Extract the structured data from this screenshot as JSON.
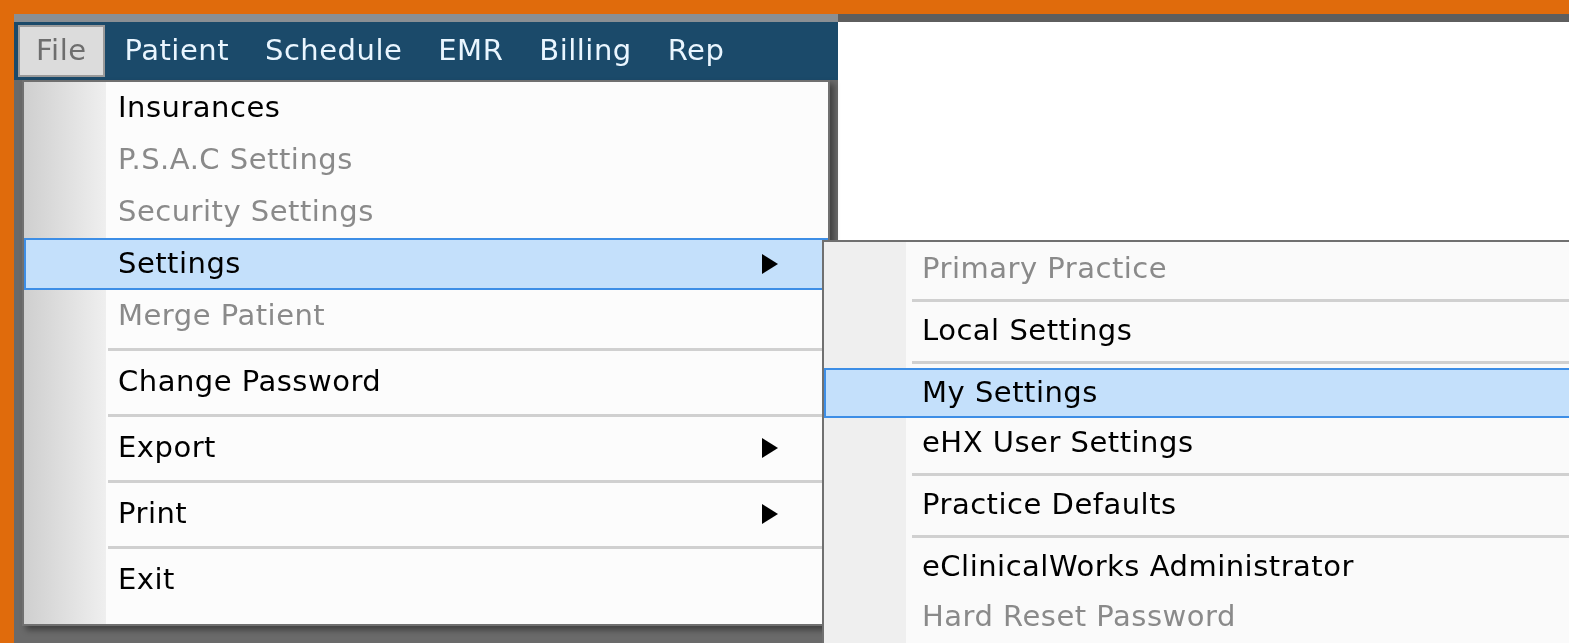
{
  "menubar": [
    {
      "label": "File",
      "selected": true
    },
    {
      "label": "Patient",
      "selected": false
    },
    {
      "label": "Schedule",
      "selected": false
    },
    {
      "label": "EMR",
      "selected": false
    },
    {
      "label": "Billing",
      "selected": false
    },
    {
      "label": "Rep",
      "selected": false
    }
  ],
  "file_menu": [
    {
      "kind": "item",
      "label": "Insurances",
      "disabled": false,
      "selected": false,
      "submenu": false
    },
    {
      "kind": "item",
      "label": "P.S.A.C Settings",
      "disabled": true,
      "selected": false,
      "submenu": false
    },
    {
      "kind": "item",
      "label": "Security Settings",
      "disabled": true,
      "selected": false,
      "submenu": false
    },
    {
      "kind": "item",
      "label": "Settings",
      "disabled": false,
      "selected": true,
      "submenu": true
    },
    {
      "kind": "item",
      "label": "Merge Patient",
      "disabled": true,
      "selected": false,
      "submenu": false
    },
    {
      "kind": "separator"
    },
    {
      "kind": "item",
      "label": "Change Password",
      "disabled": false,
      "selected": false,
      "submenu": false
    },
    {
      "kind": "separator"
    },
    {
      "kind": "item",
      "label": "Export",
      "disabled": false,
      "selected": false,
      "submenu": true
    },
    {
      "kind": "separator"
    },
    {
      "kind": "item",
      "label": "Print",
      "disabled": false,
      "selected": false,
      "submenu": true
    },
    {
      "kind": "separator"
    },
    {
      "kind": "item",
      "label": "Exit",
      "disabled": false,
      "selected": false,
      "submenu": false
    }
  ],
  "settings_submenu": [
    {
      "kind": "item",
      "label": "Primary Practice",
      "disabled": true,
      "selected": false,
      "submenu": false
    },
    {
      "kind": "separator"
    },
    {
      "kind": "item",
      "label": "Local Settings",
      "disabled": false,
      "selected": false,
      "submenu": false
    },
    {
      "kind": "separator"
    },
    {
      "kind": "item",
      "label": "My Settings",
      "disabled": false,
      "selected": true,
      "submenu": false
    },
    {
      "kind": "item",
      "label": "eHX User Settings",
      "disabled": false,
      "selected": false,
      "submenu": false
    },
    {
      "kind": "separator"
    },
    {
      "kind": "item",
      "label": "Practice Defaults",
      "disabled": false,
      "selected": false,
      "submenu": false
    },
    {
      "kind": "separator"
    },
    {
      "kind": "item",
      "label": "eClinicalWorks Administrator",
      "disabled": false,
      "selected": false,
      "submenu": false
    },
    {
      "kind": "item",
      "label": "Hard Reset Password",
      "disabled": true,
      "selected": false,
      "submenu": false
    }
  ]
}
